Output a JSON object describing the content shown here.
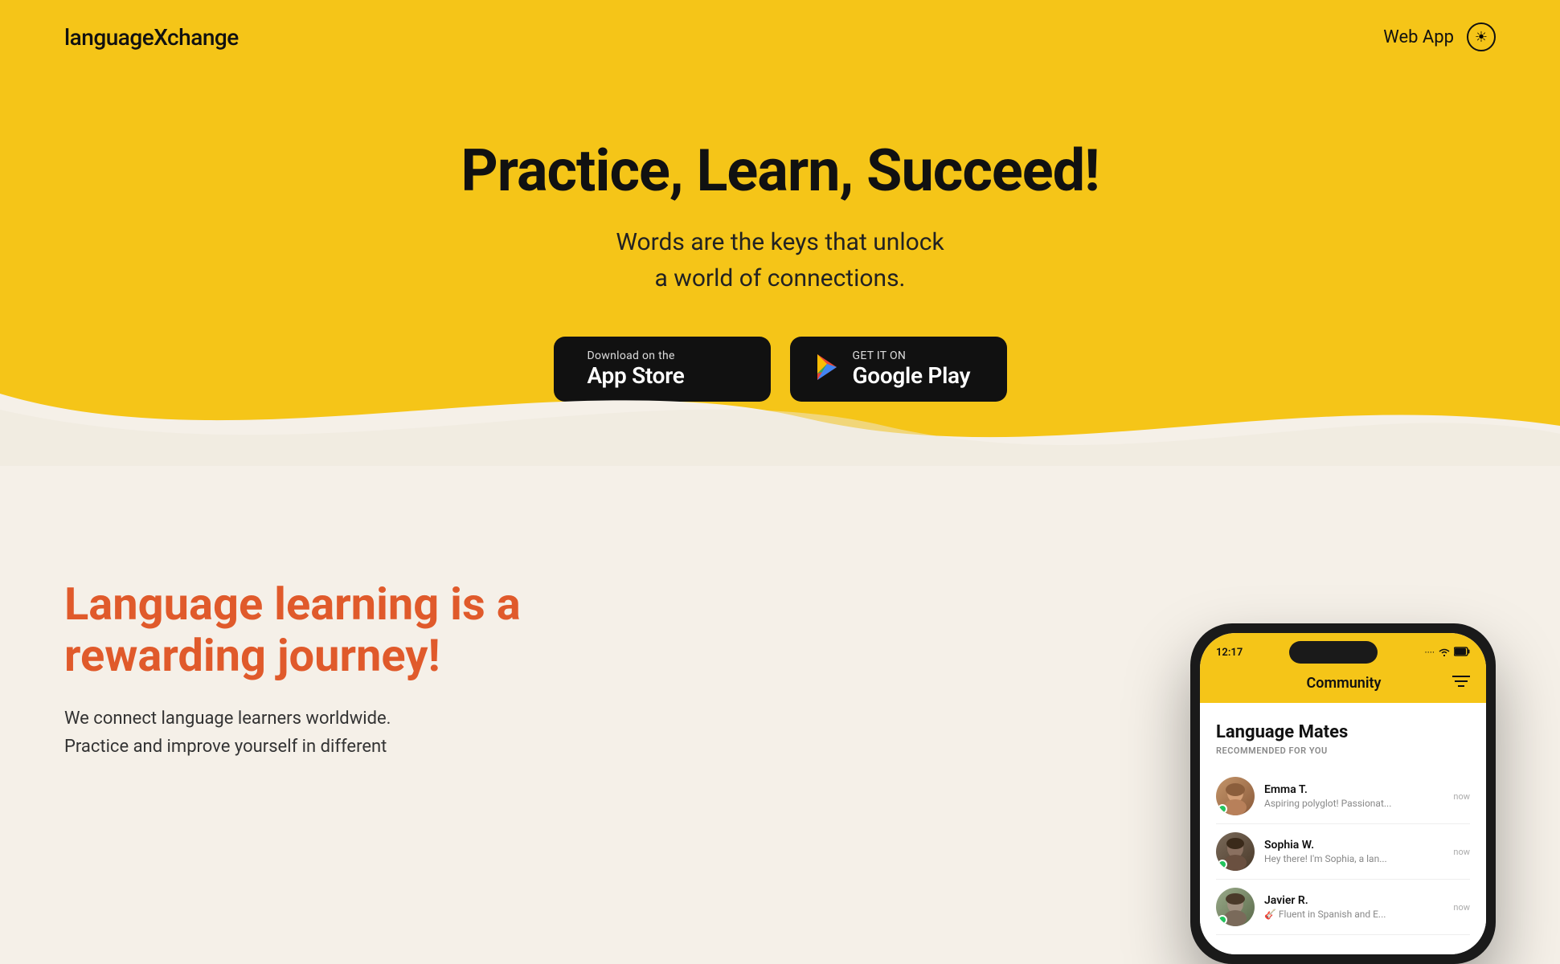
{
  "header": {
    "logo": "languageXchange",
    "nav": {
      "web_app_label": "Web App"
    },
    "theme_icon": "☀"
  },
  "hero": {
    "title": "Practice, Learn, Succeed!",
    "subtitle_line1": "Words are the keys that unlock",
    "subtitle_line2": "a world of connections.",
    "app_store": {
      "small_text": "Download on the",
      "large_text": "App Store",
      "icon": ""
    },
    "google_play": {
      "small_text": "GET IT ON",
      "large_text": "Google Play",
      "icon": "▶"
    }
  },
  "content": {
    "section_title_line1": "Language learning is a",
    "section_title_line2": "rewarding journey!",
    "description_line1": "We connect language learners worldwide.",
    "description_line2": "Practice and improve yourself in different"
  },
  "phone": {
    "status_time": "12:17",
    "community_title": "Community",
    "language_mates_title": "Language Mates",
    "recommended_label": "RECOMMENDED FOR YOU",
    "users": [
      {
        "name": "Emma T.",
        "bio": "Aspiring polyglot! Passionat...",
        "time": "now",
        "avatar_color": "emma"
      },
      {
        "name": "Sophia W.",
        "bio": "Hey there! I'm Sophia, a lan...",
        "time": "now",
        "avatar_color": "sophia"
      },
      {
        "name": "Javier R.",
        "bio": "🎸 Fluent in Spanish and E...",
        "time": "now",
        "avatar_color": "javier"
      }
    ]
  },
  "colors": {
    "hero_bg": "#F5C518",
    "section_title_color": "#E05A2B",
    "body_bg": "#f5f0e8"
  }
}
